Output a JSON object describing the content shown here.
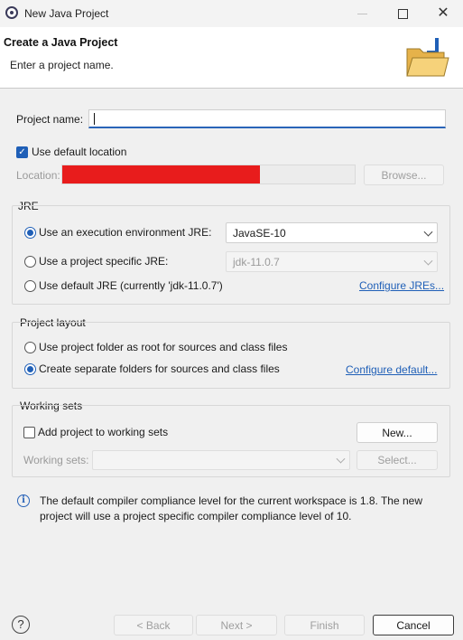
{
  "window": {
    "title": "New Java Project"
  },
  "header": {
    "title": "Create a Java Project",
    "subtitle": "Enter a project name."
  },
  "project_name": {
    "label": "Project name:",
    "value": ""
  },
  "default_location": {
    "label": "Use default location",
    "checked": true
  },
  "location": {
    "label": "Location:",
    "browse_label": "Browse..."
  },
  "jre": {
    "group_label": "JRE",
    "options": [
      {
        "label": "Use an execution environment JRE:",
        "selected": true
      },
      {
        "label": "Use a project specific JRE:",
        "selected": false
      },
      {
        "label": "Use default JRE (currently 'jdk-11.0.7')",
        "selected": false
      }
    ],
    "environment_value": "JavaSE-10",
    "specific_value": "jdk-11.0.7",
    "configure_link": "Configure JREs..."
  },
  "layout": {
    "group_label": "Project layout",
    "options": [
      {
        "label": "Use project folder as root for sources and class files",
        "selected": false
      },
      {
        "label": "Create separate folders for sources and class files",
        "selected": true
      }
    ],
    "configure_link": "Configure default..."
  },
  "working_sets": {
    "group_label": "Working sets",
    "add_label": "Add project to working sets",
    "add_checked": false,
    "new_label": "New...",
    "sets_label": "Working sets:",
    "select_label": "Select..."
  },
  "info": {
    "line1": "The default compiler compliance level for the current workspace is 1.8. The new",
    "line2": "project will use a project specific compiler compliance level of 10."
  },
  "footer": {
    "back_label": "< Back",
    "next_label": "Next >",
    "finish_label": "Finish",
    "cancel_label": "Cancel"
  },
  "colors": {
    "accent": "#1f5fb7",
    "redaction": "#e81c1c"
  },
  "icons": [
    "app-icon",
    "minimize-icon",
    "maximize-icon",
    "close-icon",
    "folder-wizard-icon",
    "info-icon",
    "help-icon",
    "chevron-down-icon"
  ]
}
